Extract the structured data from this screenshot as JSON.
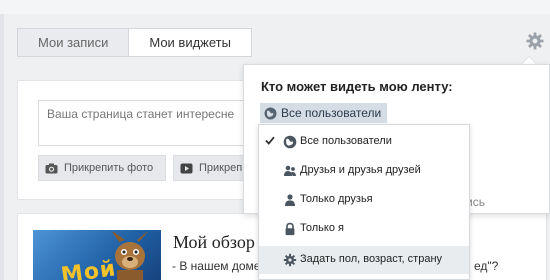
{
  "top_fragment": "- В нашем доме",
  "tabs": [
    {
      "label": "Мои записи",
      "active": true
    },
    {
      "label": "Мои виджеты",
      "active": false
    }
  ],
  "composer": {
    "placeholder": "Ваша страница станет интересне",
    "attach_photo": "Прикрепить фото",
    "attach_video": "Прикреп"
  },
  "post": {
    "title": "Мой обзор",
    "line1": "- В нашем доме",
    "tail": "ед\"?",
    "partial": "ись",
    "thumb_logo": "Мой"
  },
  "popup": {
    "heading": "Кто может видеть мою ленту:",
    "current": "Все пользователи"
  },
  "dropdown": {
    "selected_index": 0,
    "hovered_index": 5,
    "items": [
      {
        "label": "Все пользователи",
        "icon": "globe-icon"
      },
      {
        "label": "Друзья и друзья друзей",
        "icon": "users-icon"
      },
      {
        "label": "Только друзья",
        "icon": "user-icon"
      },
      {
        "label": "Только я",
        "icon": "lock-icon"
      },
      {
        "label": "Задать пол, возраст, страну",
        "icon": "gear-icon"
      }
    ]
  },
  "colors": {
    "accent_bg": "#d4dde6",
    "hover_bg": "#e9ecef",
    "page_bg": "#eef0f2"
  }
}
